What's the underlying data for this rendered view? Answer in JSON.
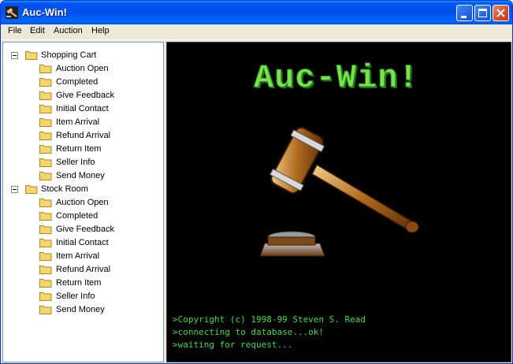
{
  "window": {
    "title": "Auc-Win!"
  },
  "menu": [
    "File",
    "Edit",
    "Auction",
    "Help"
  ],
  "tree": [
    {
      "label": "Shopping Cart",
      "expanded": true,
      "children": [
        "Auction Open",
        "Completed",
        "Give Feedback",
        "Initial Contact",
        "Item Arrival",
        "Refund Arrival",
        "Return Item",
        "Seller Info",
        "Send Money"
      ]
    },
    {
      "label": "Stock Room",
      "expanded": true,
      "children": [
        "Auction Open",
        "Completed",
        "Give Feedback",
        "Initial Contact",
        "Item Arrival",
        "Refund Arrival",
        "Return Item",
        "Seller Info",
        "Send Money"
      ]
    }
  ],
  "display": {
    "logo_text": "Auc-Win!",
    "console": [
      ">Copyright (c) 1998-99 Steven S. Read",
      ">connecting to database...ok!",
      ">waiting for request..."
    ]
  },
  "colors": {
    "title_bar": "#0054e3",
    "console_text": "#3cde3c",
    "logo_text": "#7fe04f",
    "display_bg": "#000000"
  },
  "icons": {
    "app": "gavel-icon",
    "tree": "folder-icon"
  }
}
